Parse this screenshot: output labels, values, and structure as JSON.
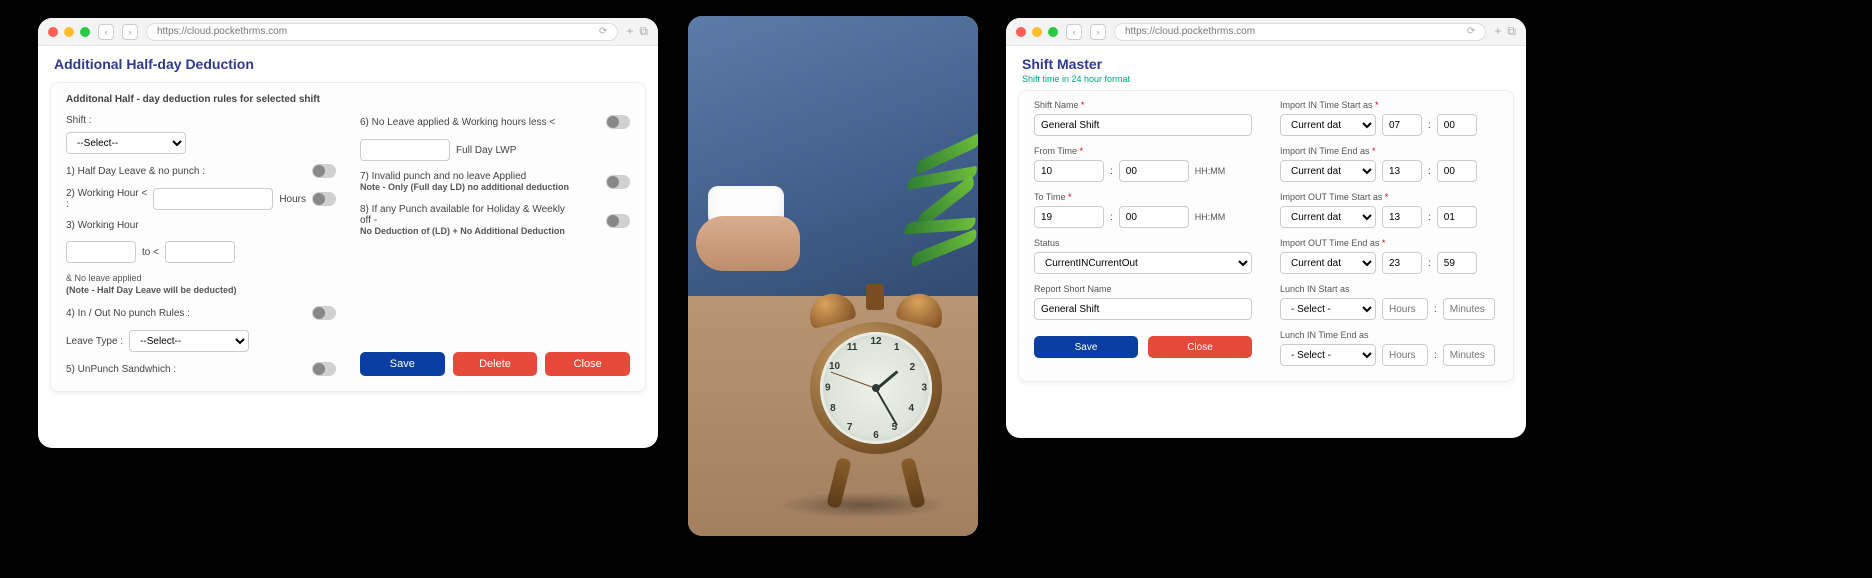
{
  "browser": {
    "url": "https://cloud.pockethrms.com",
    "nav_back": "‹",
    "nav_fwd": "›",
    "reload": "⟳",
    "plus": "+",
    "expand": "⧉"
  },
  "panel_a": {
    "title": "Additional Half-day Deduction",
    "card_title": "Additonal Half - day deduction rules for selected shift",
    "shift_label": "Shift :",
    "shift_select": "--Select--",
    "rule1": "1)   Half Day Leave & no punch :",
    "rule2": "2)   Working Hour < :",
    "hours_suffix": "Hours",
    "rule3": "3)   Working Hour",
    "to_label": "to <",
    "note3a": "& No leave applied",
    "note3b": "(Note - Half Day Leave will be deducted)",
    "rule4": "4)   In / Out No punch Rules :",
    "leave_type_label": "Leave Type :",
    "leave_type_select": "--Select--",
    "rule5": "5)   UnPunch Sandwhich :",
    "rule6": "6)   No Leave applied & Working hours less <",
    "full_day_lwp": "Full Day LWP",
    "rule7a": "7)   Invalid punch and no leave Applied",
    "rule7b": "Note - Only (Full day LD) no additional deduction",
    "rule8a": "8)   If any Punch available for Holiday & Weekly off -",
    "rule8b": "No Deduction of (LD) + No Additional Deduction",
    "btn_save": "Save",
    "btn_delete": "Delete",
    "btn_close": "Close"
  },
  "panel_c": {
    "title": "Shift Master",
    "note": "Shift time in 24 hour format",
    "shift_name_label": "Shift Name",
    "shift_name_value": "General Shift",
    "from_time_label": "From Time",
    "from_h": "10",
    "from_m": "00",
    "hhmm": "HH:MM",
    "to_time_label": "To Time",
    "to_h": "19",
    "to_m": "00",
    "status_label": "Status",
    "status_value": "CurrentINCurrentOut",
    "report_label": "Report Short Name",
    "report_value": "General Shift",
    "imp_in_start_label": "Import IN Time Start as",
    "current_date": "Current date",
    "imp_in_start_h": "07",
    "imp_in_start_m": "00",
    "imp_in_end_label": "Import IN Time End as",
    "imp_in_end_h": "13",
    "imp_in_end_m": "00",
    "imp_out_start_label": "Import OUT Time Start as",
    "imp_out_start_h": "13",
    "imp_out_start_m": "01",
    "imp_out_end_label": "Import OUT Time End as",
    "imp_out_end_h": "23",
    "imp_out_end_m": "59",
    "lunch_in_start_label": "Lunch IN Start as",
    "select_placeholder": "- Select -",
    "hours_ph": "Hours",
    "minutes_ph": "Minutes",
    "colon": ":",
    "lunch_in_end_label": "Lunch IN Time End as",
    "btn_save": "Save",
    "btn_close": "Close"
  }
}
